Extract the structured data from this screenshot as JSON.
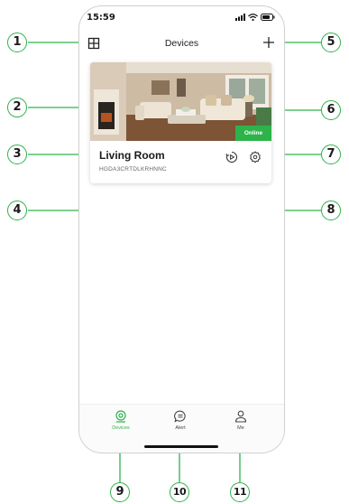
{
  "status_bar": {
    "time": "15:59",
    "icons": [
      "signal-icon",
      "wifi-icon",
      "battery-icon"
    ]
  },
  "header": {
    "title": "Devices",
    "left_icon": "grid-icon",
    "right_icon": "plus-icon"
  },
  "device": {
    "name": "Living Room",
    "id": "HGDA3CRTDLKRHNNC",
    "status": "Online",
    "thumbnail": "living-room-photo"
  },
  "tabs": [
    {
      "label": "Devices",
      "icon": "camera-icon",
      "active": true
    },
    {
      "label": "Alert",
      "icon": "chat-icon",
      "active": false
    },
    {
      "label": "Me",
      "icon": "user-icon",
      "active": false
    }
  ],
  "callouts": [
    "1",
    "2",
    "3",
    "4",
    "5",
    "6",
    "7",
    "8",
    "9",
    "10",
    "11"
  ],
  "colors": {
    "accent": "#2db34a",
    "text": "#1a1a1a",
    "muted": "#666666"
  }
}
